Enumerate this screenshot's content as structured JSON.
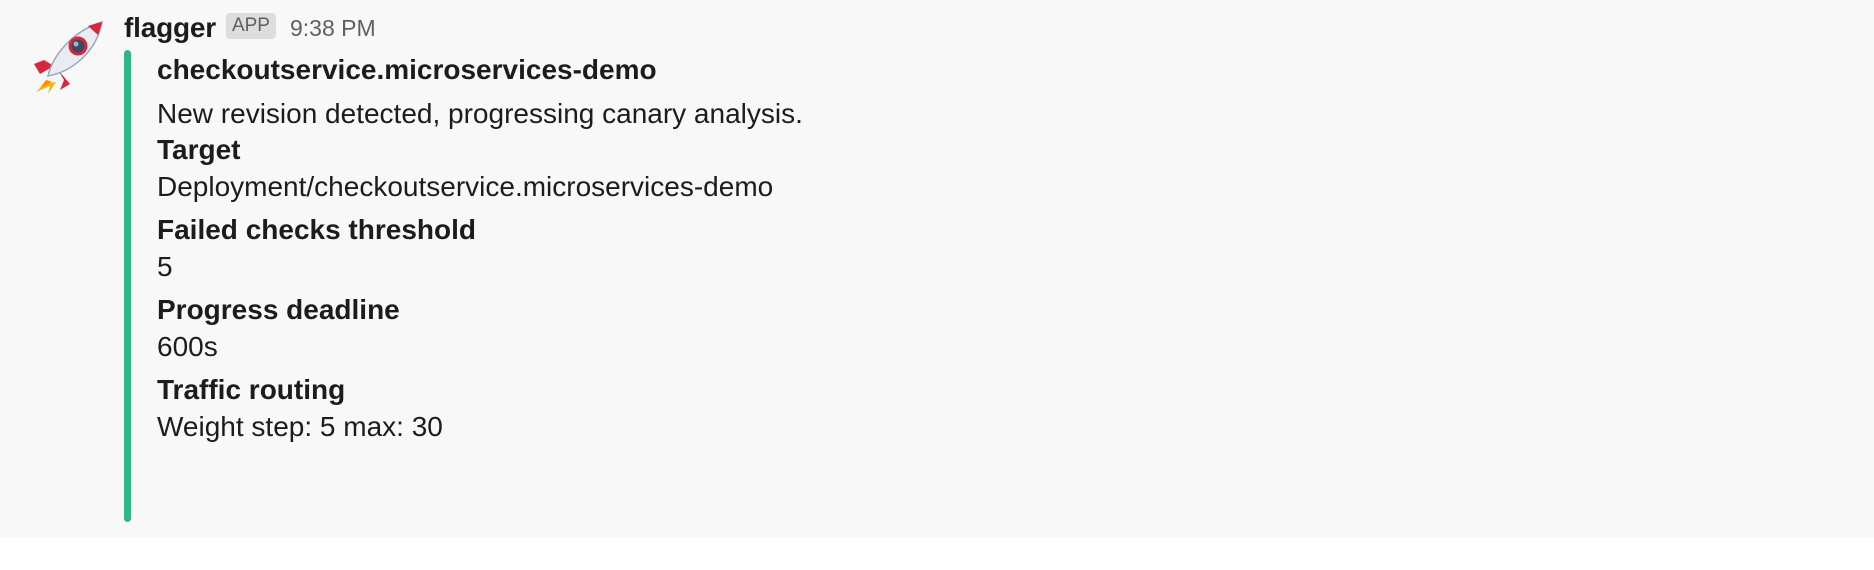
{
  "message": {
    "sender": "flagger",
    "badge": "APP",
    "timestamp": "9:38 PM",
    "avatar_icon": "rocket-icon"
  },
  "attachment": {
    "color": "#2eb886",
    "title": "checkoutservice.microservices-demo",
    "text": "New revision detected, progressing canary analysis.",
    "fields": [
      {
        "title": "Target",
        "value": "Deployment/checkoutservice.microservices-demo"
      },
      {
        "title": "Failed checks threshold",
        "value": "5"
      },
      {
        "title": "Progress deadline",
        "value": "600s"
      },
      {
        "title": "Traffic routing",
        "value": "Weight step: 5 max: 30"
      }
    ]
  }
}
